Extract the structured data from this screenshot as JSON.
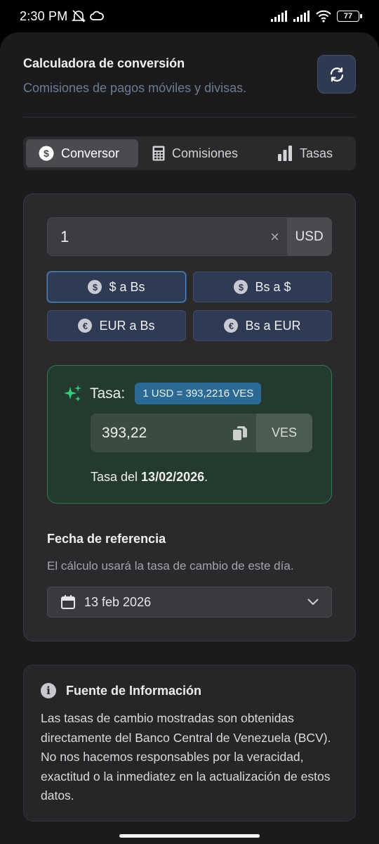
{
  "status_bar": {
    "time": "2:30 PM",
    "battery": "77"
  },
  "header": {
    "title": "Calculadora de conversión",
    "subtitle": "Comisiones de pagos móviles y divisas.",
    "refresh_icon": "refresh-icon"
  },
  "tabs": [
    {
      "label": "Conversor",
      "icon": "dollar-circle-icon",
      "active": true
    },
    {
      "label": "Comisiones",
      "icon": "calculator-icon",
      "active": false
    },
    {
      "label": "Tasas",
      "icon": "bar-chart-icon",
      "active": false
    }
  ],
  "converter": {
    "amount_value": "1",
    "clear_symbol": "×",
    "amount_unit": "USD",
    "buttons": [
      {
        "label": "$ a Bs",
        "icon_symbol": "$",
        "selected": true
      },
      {
        "label": "Bs a $",
        "icon_symbol": "$",
        "selected": false
      },
      {
        "label": "EUR a Bs",
        "icon_symbol": "€",
        "selected": false
      },
      {
        "label": "Bs a EUR",
        "icon_symbol": "€",
        "selected": false
      }
    ],
    "rate": {
      "label": "Tasa:",
      "badge": "1 USD = 393,2216 VES",
      "value": "393,22",
      "unit": "VES",
      "date_prefix": "Tasa del ",
      "date": "13/02/2026",
      "date_suffix": "."
    },
    "reference": {
      "title": "Fecha de referencia",
      "description": "El cálculo usará la tasa de cambio de este día.",
      "selected_date": "13 feb 2026"
    }
  },
  "info": {
    "icon_symbol": "i",
    "title": "Fuente de Información",
    "text": "Las tasas de cambio mostradas son obtenidas directamente del Banco Central de Venezuela (BCV). No nos hacemos responsables por la veracidad, exactitud o la inmediatez en la actualización de estos datos."
  },
  "colors": {
    "accent_green": "#2fd27a",
    "selected_border": "#4a8fd8",
    "rate_badge": "#2d6a93"
  }
}
